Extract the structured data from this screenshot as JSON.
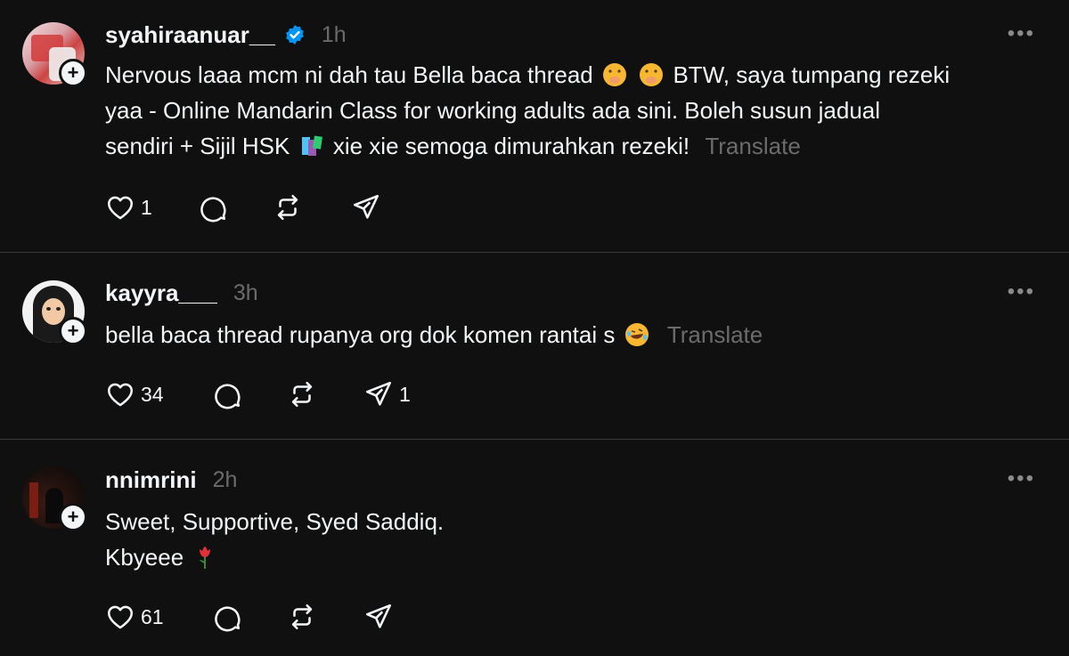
{
  "posts": [
    {
      "username": "syahiraanuar__",
      "verified": true,
      "time": "1h",
      "text_parts": [
        "Nervous laaa mcm ni dah tau Bella baca thread",
        "BTW, saya tumpang rezeki",
        "yaa - Online Mandarin Class for working adults ada sini. Boleh susun jadual",
        "sendiri + Sijil HSK",
        "xie xie semoga dimurahkan rezeki!"
      ],
      "translate": "Translate",
      "likes": "1",
      "shares": ""
    },
    {
      "username": "kayyra___",
      "verified": false,
      "time": "3h",
      "text_parts": [
        "bella baca thread rupanya org dok komen rantai s"
      ],
      "translate": "Translate",
      "likes": "34",
      "shares": "1"
    },
    {
      "username": "nnimrini",
      "verified": false,
      "time": "2h",
      "text_parts": [
        "Sweet, Supportive, Syed Saddiq.",
        "Kbyeee"
      ],
      "translate": "",
      "likes": "61",
      "shares": ""
    }
  ],
  "colors": {
    "background": "#101010",
    "text": "#f3f5f7",
    "muted": "#6b6b6b",
    "verified": "#0095f6",
    "divider": "#3a3a3a"
  },
  "icons": [
    "follow-plus-icon",
    "verified-badge-icon",
    "more-icon",
    "heart-icon",
    "comment-icon",
    "repost-icon",
    "share-icon"
  ]
}
